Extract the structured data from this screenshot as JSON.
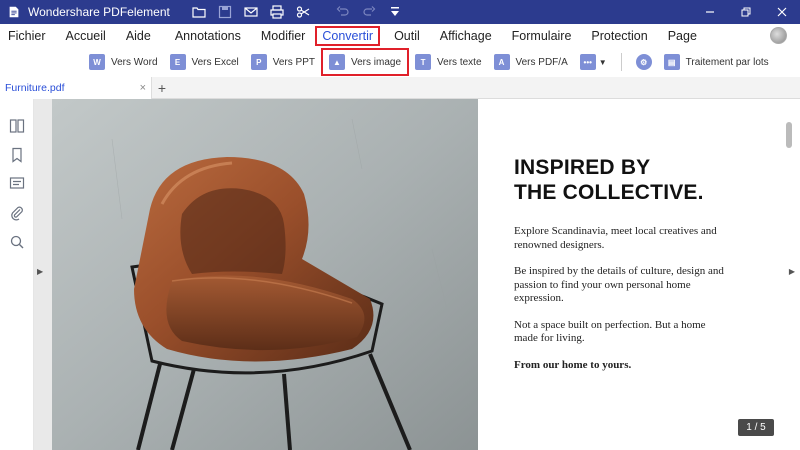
{
  "titlebar": {
    "title": "Wondershare PDFelement",
    "quick_icons": [
      "folder-icon",
      "save-icon",
      "mail-icon",
      "print-icon",
      "scissors-icon",
      "undo-icon",
      "redo-icon",
      "dropdown-icon"
    ],
    "bg_color": "#2c3b8e"
  },
  "menu": {
    "items": [
      "Fichier",
      "Accueil",
      "Aide",
      "Annotations",
      "Modifier",
      "Convertir",
      "Outil",
      "Affichage",
      "Formulaire",
      "Protection",
      "Page"
    ],
    "active": "Convertir",
    "active_color": "#2a4fd8",
    "highlight_color": "#e0202a"
  },
  "ribbon": {
    "buttons": [
      {
        "label": "Vers Word",
        "icon": "word-icon",
        "glyph": "W"
      },
      {
        "label": "Vers Excel",
        "icon": "excel-icon",
        "glyph": "E"
      },
      {
        "label": "Vers PPT",
        "icon": "ppt-icon",
        "glyph": "P"
      },
      {
        "label": "Vers image",
        "icon": "image-icon",
        "glyph": "▲"
      },
      {
        "label": "Vers texte",
        "icon": "text-icon",
        "glyph": "T"
      },
      {
        "label": "Vers PDF/A",
        "icon": "pdfa-icon",
        "glyph": "A"
      }
    ],
    "more_icon": "more-formats-icon",
    "settings_icon": "gear-icon",
    "batch_label": "Traitement par lots",
    "batch_icon": "batch-icon"
  },
  "tab": {
    "filename": "Furniture.pdf",
    "close": "×",
    "add": "+"
  },
  "sidebar_icons": [
    "thumbnails-icon",
    "bookmark-icon",
    "comment-icon",
    "attachment-icon",
    "search-icon"
  ],
  "document": {
    "headline": "INSPIRED BY\nTHE COLLECTIVE.",
    "paragraphs": [
      "Explore Scandinavia, meet local creatives and renowned designers.",
      "Be inspired by the details of culture, design and passion to find your own personal home expression.",
      "Not a space built on perfection. But a home made for living."
    ],
    "tagline": "From our home to yours.",
    "photo": "leather-chair-photo"
  },
  "page_indicator": "1 / 5"
}
